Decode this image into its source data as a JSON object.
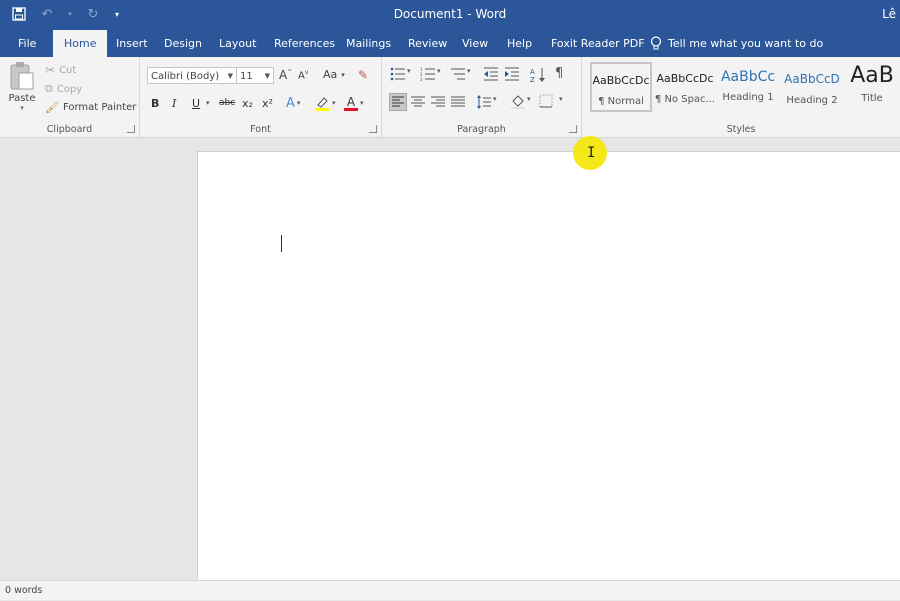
{
  "title_bar": {
    "document_title": "Document1  -  Word",
    "user_initials": "Lê",
    "quick_access": {
      "save_icon": "save-icon",
      "undo_icon": "undo-icon",
      "redo_icon": "redo-icon",
      "customize_icon": "customize-qat-icon"
    }
  },
  "tabs": [
    {
      "label": "File"
    },
    {
      "label": "Home",
      "active": true
    },
    {
      "label": "Insert"
    },
    {
      "label": "Design"
    },
    {
      "label": "Layout"
    },
    {
      "label": "References"
    },
    {
      "label": "Mailings"
    },
    {
      "label": "Review"
    },
    {
      "label": "View"
    },
    {
      "label": "Help"
    },
    {
      "label": "Foxit Reader PDF"
    }
  ],
  "tell_me": {
    "label": "Tell me what you want to do"
  },
  "clipboard": {
    "label": "Clipboard",
    "paste": "Paste",
    "cut": "Cut",
    "copy": "Copy",
    "format_painter": "Format Painter"
  },
  "font": {
    "label": "Font",
    "family": "Calibri (Body)",
    "size": "11",
    "change_case": "Aa",
    "bold": "B",
    "italic": "I",
    "underline": "U",
    "strike": "abc",
    "subscript": "x₂",
    "superscript": "x²",
    "text_effects": "A",
    "highlight_color": "#ffff00",
    "font_color": "#e81123",
    "font_color_letter": "A"
  },
  "paragraph": {
    "label": "Paragraph",
    "show_marks": "¶"
  },
  "styles": {
    "label": "Styles",
    "items": [
      {
        "sample": "AaBbCcDc",
        "name": "¶ Normal",
        "selected": true
      },
      {
        "sample": "AaBbCcDc",
        "name": "¶ No Spac..."
      },
      {
        "sample": "AaBbCc",
        "name": "Heading 1"
      },
      {
        "sample": "AaBbCcD",
        "name": "Heading 2"
      },
      {
        "sample": "AaB",
        "name": "Title"
      }
    ]
  },
  "status": {
    "words": "0 words"
  },
  "colors": {
    "accent": "#2b579a",
    "ribbon_bg": "#f3f3f3",
    "workspace_bg": "#e6e6e6",
    "cursor_highlight": "#f5e700"
  }
}
